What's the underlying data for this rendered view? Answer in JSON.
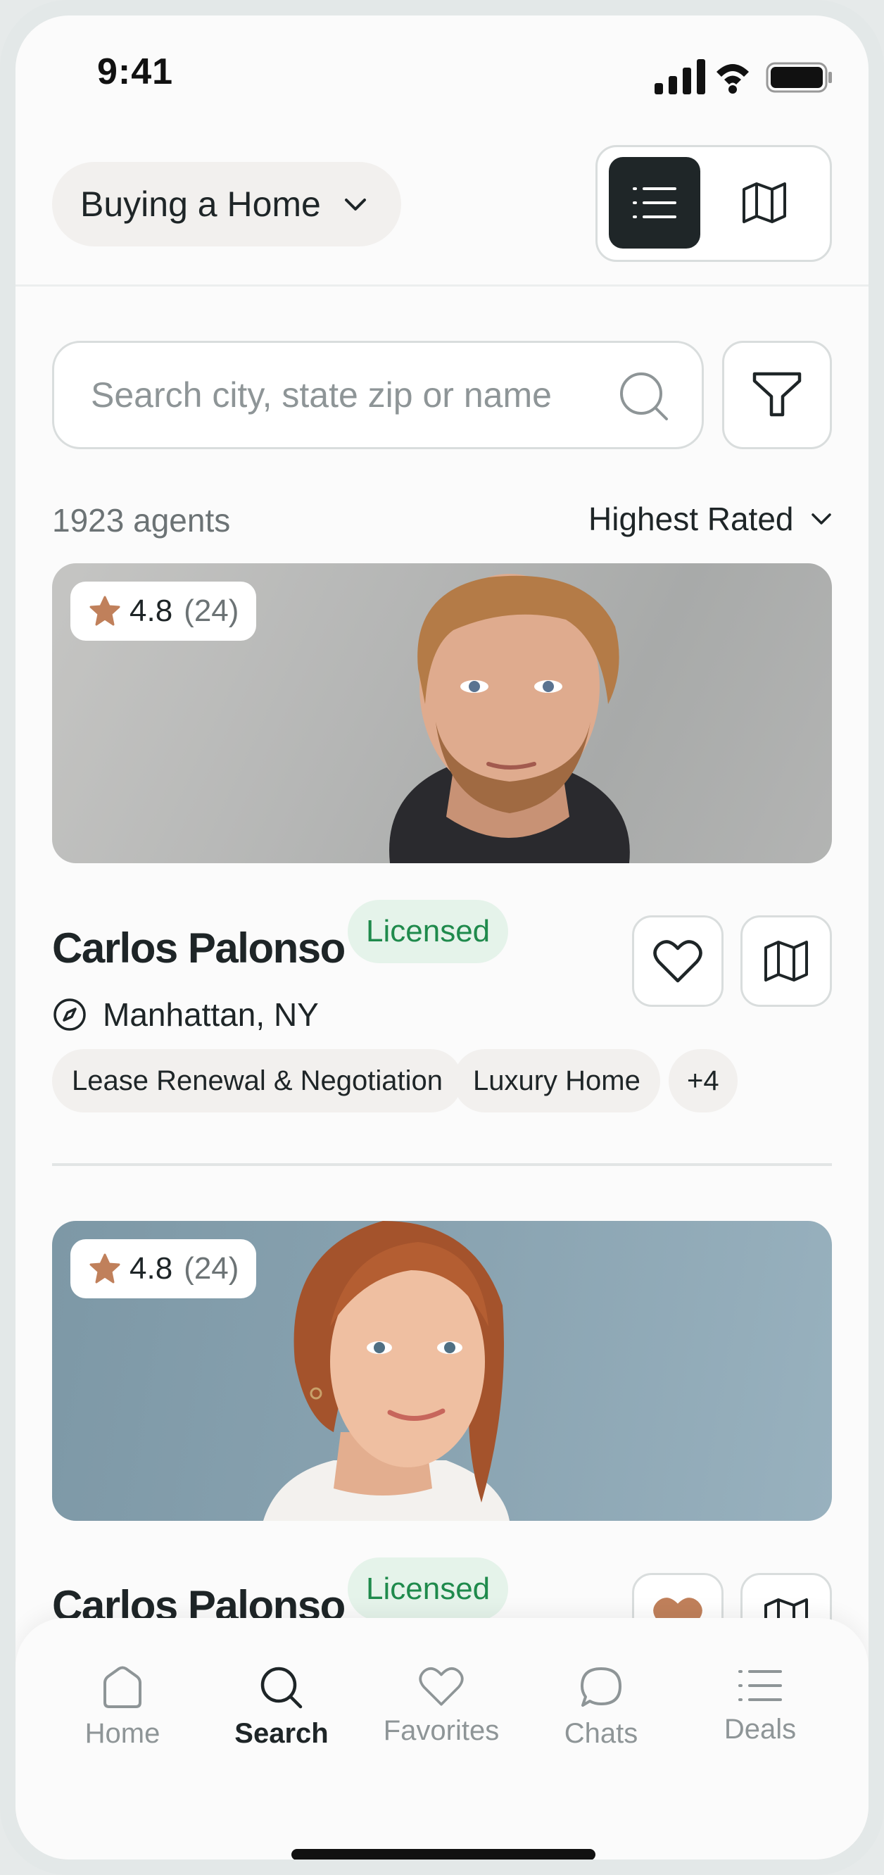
{
  "status_bar": {
    "time": "9:41"
  },
  "header": {
    "mode_label": "Buying a Home",
    "view_options": [
      "list-icon",
      "map-icon"
    ],
    "active_view": "list"
  },
  "search": {
    "placeholder": "Search city, state zip or name",
    "value": ""
  },
  "results": {
    "count_label": "1923 agents",
    "sort_label": "Highest Rated"
  },
  "agents": [
    {
      "rating": "4.8",
      "reviews": "(24)",
      "name": "Carlos Palonso",
      "badge": "Licensed",
      "location": "Manhattan, NY",
      "tags": [
        "Lease Renewal & Negotiation",
        "Luxury Home",
        "+4"
      ],
      "favorited": false
    },
    {
      "rating": "4.8",
      "reviews": "(24)",
      "name": "Carlos Palonso",
      "badge": "Licensed",
      "favorited": true
    }
  ],
  "tabbar": {
    "items": [
      {
        "label": "Home",
        "icon": "home-icon"
      },
      {
        "label": "Search",
        "icon": "search-icon"
      },
      {
        "label": "Favorites",
        "icon": "heart-icon"
      },
      {
        "label": "Chats",
        "icon": "chat-bubble-icon"
      },
      {
        "label": "Deals",
        "icon": "list-icon"
      }
    ],
    "active": "Search"
  },
  "colors": {
    "accent_dark": "#1f2628",
    "star": "#c0805b",
    "licensed_bg": "#e5f3ea",
    "licensed_text": "#1f8a4c",
    "chip_bg": "#f2f0ee"
  }
}
